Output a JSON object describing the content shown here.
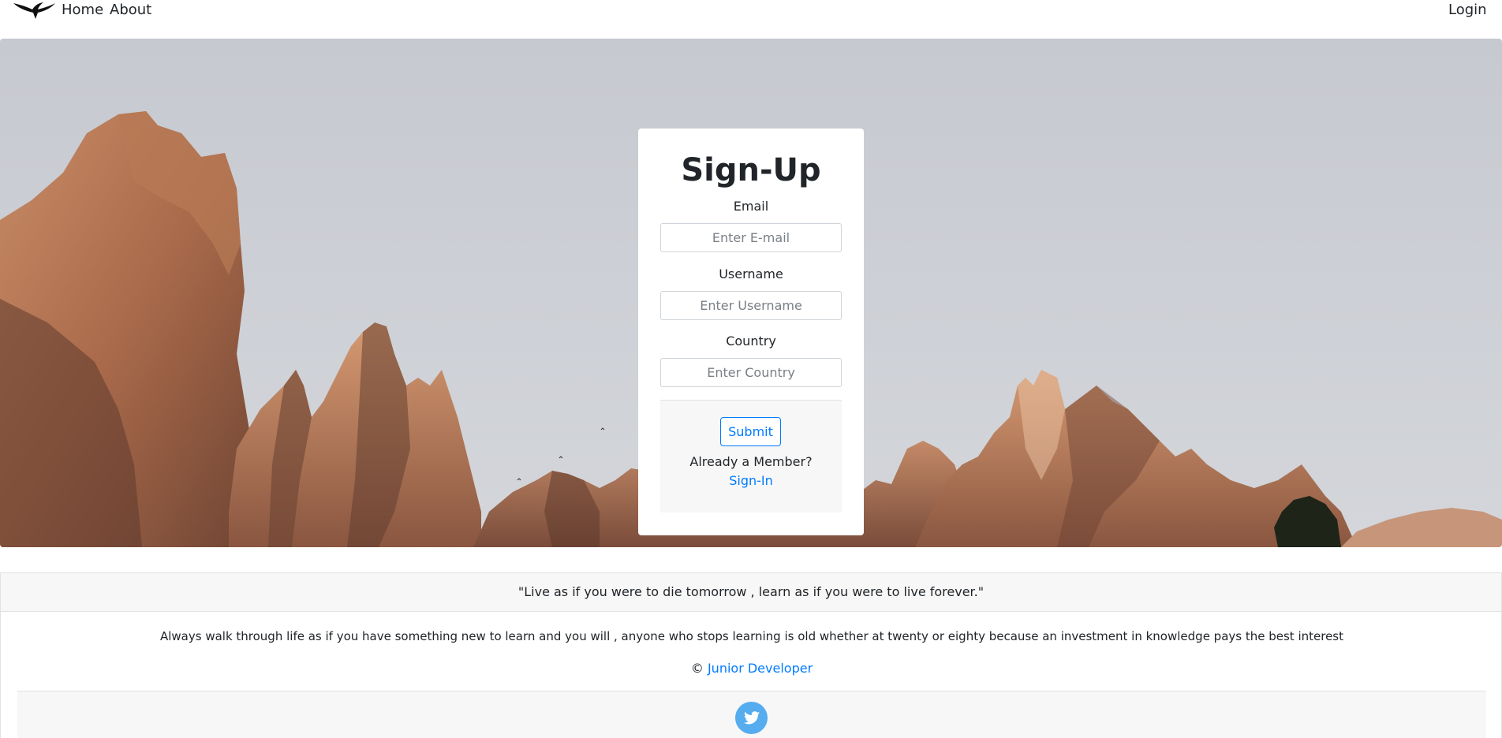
{
  "navbar": {
    "logo_icon": "eagle-icon",
    "home_label": "Home",
    "about_label": "About",
    "login_label": "Login"
  },
  "signup": {
    "title": "Sign-Up",
    "email_label": "Email",
    "email_placeholder": "Enter E-mail",
    "username_label": "Username",
    "username_placeholder": "Enter Username",
    "country_label": "Country",
    "country_placeholder": "Enter Country",
    "submit_label": "Submit",
    "member_text": "Already a Member?",
    "signin_label": "Sign-In"
  },
  "footer": {
    "quote": "\"Live as if you were to die tomorrow , learn as if you were to live forever.\"",
    "text": "Always walk through life as if you have something new to learn and you will , anyone who stops learning is old whether at twenty or eighty because an investment in knowledge pays the best interest",
    "copyright_symbol": "©",
    "author_link": "Junior Developer",
    "social_icon": "twitter-icon"
  },
  "colors": {
    "accent": "#007bff",
    "twitter": "#55acee",
    "footer_bg": "#f7f7f7"
  }
}
